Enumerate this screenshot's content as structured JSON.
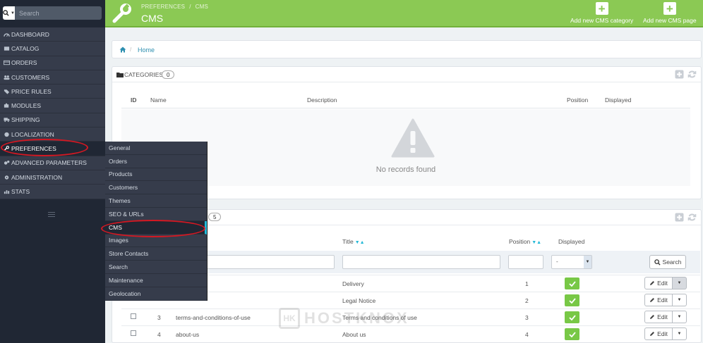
{
  "colors": {
    "accent": "#8bc954",
    "sidebar": "#363c4b",
    "link": "#25b9d7",
    "highlight_ring": "#d41822"
  },
  "sidebar": {
    "search_placeholder": "Search",
    "items": [
      {
        "label": "DASHBOARD",
        "icon": "dashboard-icon"
      },
      {
        "label": "CATALOG",
        "icon": "book-icon"
      },
      {
        "label": "ORDERS",
        "icon": "credit-card-icon"
      },
      {
        "label": "CUSTOMERS",
        "icon": "users-icon"
      },
      {
        "label": "PRICE RULES",
        "icon": "tag-icon"
      },
      {
        "label": "MODULES",
        "icon": "puzzle-icon"
      },
      {
        "label": "SHIPPING",
        "icon": "truck-icon"
      },
      {
        "label": "LOCALIZATION",
        "icon": "globe-icon"
      },
      {
        "label": "PREFERENCES",
        "icon": "wrench-icon"
      },
      {
        "label": "ADVANCED PARAMETERS",
        "icon": "cogs-icon"
      },
      {
        "label": "ADMINISTRATION",
        "icon": "cog-icon"
      },
      {
        "label": "STATS",
        "icon": "bar-chart-icon"
      }
    ]
  },
  "flyout": {
    "items": [
      "General",
      "Orders",
      "Products",
      "Customers",
      "Themes",
      "SEO & URLs",
      "CMS",
      "Images",
      "Store Contacts",
      "Search",
      "Maintenance",
      "Geolocation"
    ],
    "active": "CMS"
  },
  "header": {
    "crumb": [
      "PREFERENCES",
      "/",
      "CMS"
    ],
    "title": "CMS",
    "btn_add_category": "Add new CMS category",
    "btn_add_page": "Add new CMS page"
  },
  "breadcrumb": {
    "sep": "/",
    "home": "Home"
  },
  "categories": {
    "title": "CATEGORIES",
    "count": "0",
    "columns": {
      "id": "ID",
      "name": "Name",
      "description": "Description",
      "position": "Position",
      "displayed": "Displayed"
    },
    "empty_text": "No records found"
  },
  "pages": {
    "count": "5",
    "columns": {
      "title": "Title",
      "position": "Position",
      "displayed": "Displayed"
    },
    "filter_select": "-",
    "search_label": "Search",
    "edit_label": "Edit",
    "rows": [
      {
        "id": "",
        "url": "",
        "title": "Delivery",
        "position": "1"
      },
      {
        "id": "",
        "url": "",
        "title": "Legal Notice",
        "position": "2"
      },
      {
        "id": "3",
        "url": "terms-and-conditions-of-use",
        "title": "Terms and conditions of use",
        "position": "3"
      },
      {
        "id": "4",
        "url": "about-us",
        "title": "About us",
        "position": "4"
      }
    ]
  },
  "watermark": "HOSTKNOX"
}
